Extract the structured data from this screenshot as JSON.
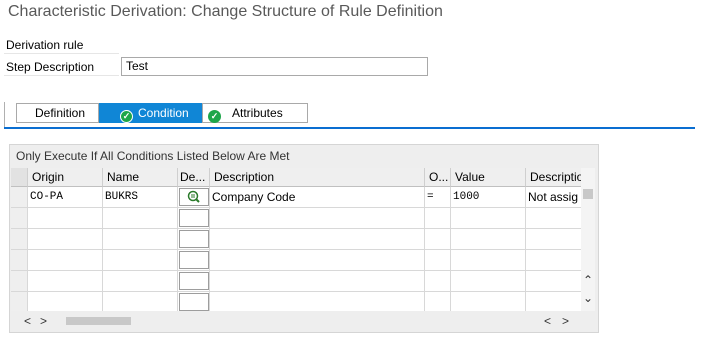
{
  "window": {
    "title": "Characteristic Derivation: Change Structure of Rule Definition"
  },
  "form": {
    "derivation_rule_label": "Derivation rule",
    "step_description_label": "Step Description",
    "step_description_value": "Test"
  },
  "tabs": [
    {
      "label": "Definition",
      "icon": "none",
      "active": false
    },
    {
      "label": "Condition",
      "icon": "check-circle-icon",
      "active": true
    },
    {
      "label": "Attributes",
      "icon": "check-circle-icon",
      "active": false
    }
  ],
  "conditions": {
    "title": "Only Execute If All Conditions Listed Below Are Met",
    "headers": [
      "Origin",
      "Name",
      "De...",
      "Description",
      "O...",
      "Value",
      "Descriptio"
    ],
    "rows": [
      {
        "origin": "CO-PA",
        "name": "BUKRS",
        "description": "Company Code",
        "operator": "=",
        "value": "1000",
        "value_description": "Not assig"
      }
    ]
  },
  "colors": {
    "accent": "#1086d6",
    "check_green": "#1ea64a",
    "tab_underline": "#0a6ed1"
  }
}
